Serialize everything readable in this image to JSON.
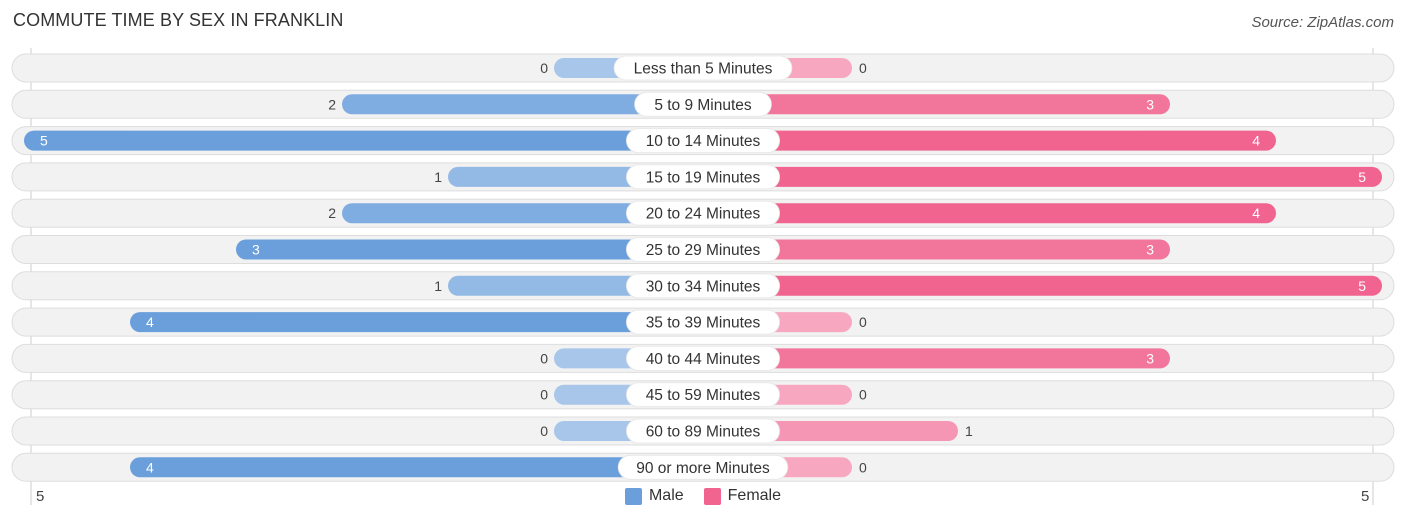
{
  "title": "COMMUTE TIME BY SEX IN FRANKLIN",
  "source": "Source: ZipAtlas.com",
  "colors": {
    "male": "#6a9fdc",
    "male_light": "#a8c6ea",
    "female": "#f0648f",
    "female_light": "#f7a8c0",
    "track": "#f2f2f2",
    "track_border": "#dddddd"
  },
  "legend": [
    {
      "label": "Male",
      "color": "#6a9fdc"
    },
    {
      "label": "Female",
      "color": "#f0648f"
    }
  ],
  "axis": {
    "left_label": "5",
    "right_label": "5"
  },
  "chart_data": {
    "type": "bar",
    "orientation": "horizontal-diverging",
    "title": "COMMUTE TIME BY SEX IN FRANKLIN",
    "categories": [
      "Less than 5 Minutes",
      "5 to 9 Minutes",
      "10 to 14 Minutes",
      "15 to 19 Minutes",
      "20 to 24 Minutes",
      "25 to 29 Minutes",
      "30 to 34 Minutes",
      "35 to 39 Minutes",
      "40 to 44 Minutes",
      "45 to 59 Minutes",
      "60 to 89 Minutes",
      "90 or more Minutes"
    ],
    "series": [
      {
        "name": "Male",
        "values": [
          0,
          2,
          5,
          1,
          2,
          3,
          1,
          4,
          0,
          0,
          0,
          4
        ]
      },
      {
        "name": "Female",
        "values": [
          0,
          3,
          4,
          5,
          4,
          3,
          5,
          0,
          3,
          0,
          1,
          0
        ]
      }
    ],
    "xlim": [
      -5,
      5
    ],
    "xlabel": "",
    "ylabel": "",
    "legend_position": "bottom-center",
    "grid": false
  }
}
